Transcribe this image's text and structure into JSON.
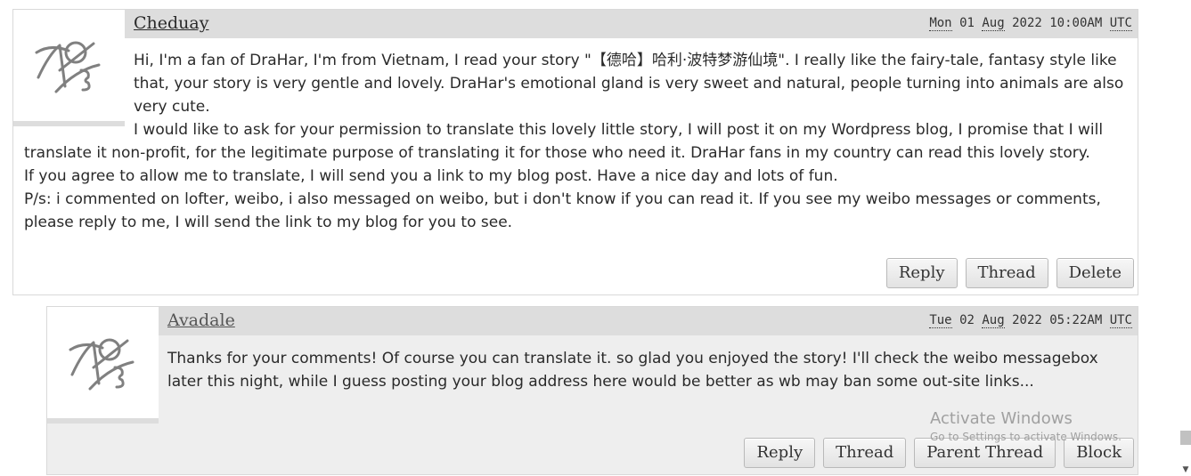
{
  "comments": [
    {
      "username": "Cheduay",
      "date": {
        "weekday": "Mon",
        "day": "01",
        "month": "Aug",
        "year": "2022",
        "time": "10:00AM",
        "zone": "UTC"
      },
      "paragraphs": [
        "Hi, I'm a fan of DraHar, I'm from Vietnam, I read your story \"【德哈】哈利·波特梦游仙境\". I really like the fairy-tale, fantasy style like that, your story is very gentle and lovely. DraHar's emotional gland is very sweet and natural, people turning into animals are also very cute.",
        "I would like to ask for your permission to translate this lovely little story, I will post it on my Wordpress blog, I promise that I will translate it non-profit, for the legitimate purpose of translating it for those who need it. DraHar fans in my country can read this lovely story.",
        "If you agree to allow me to translate, I will send you a link to my blog post. Have a nice day and lots of fun.",
        "P/s: i commented on lofter, weibo, i also messaged on weibo, but i don't know if you can read it. If you see my weibo messages or comments, please reply to me, I will send the link to my blog for you to see."
      ],
      "actions": [
        "Reply",
        "Thread",
        "Delete"
      ]
    },
    {
      "username": "Avadale",
      "date": {
        "weekday": "Tue",
        "day": "02",
        "month": "Aug",
        "year": "2022",
        "time": "05:22AM",
        "zone": "UTC"
      },
      "paragraphs": [
        "Thanks for your comments! Of course you can translate it. so glad you enjoyed the story! I'll check the weibo messagebox later this night, while I guess posting your blog address here would be better as wb may ban some out-site links..."
      ],
      "actions": [
        "Reply",
        "Thread",
        "Parent Thread",
        "Block"
      ]
    }
  ],
  "watermark": {
    "title": "Activate Windows",
    "subtitle": "Go to Settings to activate Windows."
  },
  "icons": {
    "avatar": "default-avatar-icon"
  }
}
